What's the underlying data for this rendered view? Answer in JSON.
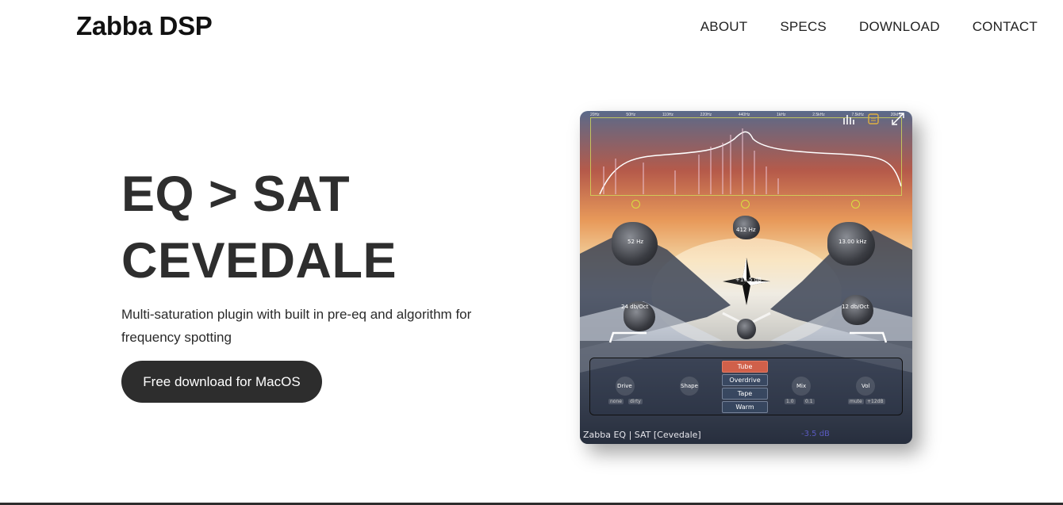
{
  "header": {
    "brand": "Zabba DSP",
    "nav": [
      "ABOUT",
      "SPECS",
      "DOWNLOAD",
      "CONTACT"
    ]
  },
  "hero": {
    "title_line1": "EQ > SAT",
    "title_line2": "CEVEDALE",
    "description": "Multi-saturation plugin with built in pre-eq and algorithm for frequency spotting",
    "cta_label": "Free download for MacOS"
  },
  "plugin": {
    "freq_labels": [
      "20Hz",
      "50Hz",
      "110Hz",
      "220Hz",
      "440Hz",
      "1kHz",
      "2.5kHz",
      "7.5kHz",
      "20kHz"
    ],
    "bands": {
      "low_freq": "52 Hz",
      "mid_freq": "412 Hz",
      "high_freq": "13.00 kHz",
      "low_slope": "24 db/Oct",
      "high_slope": "12 db/Oct",
      "center_gain": "+16.5 dB"
    },
    "controls": {
      "drive": "Drive",
      "shape": "Shape",
      "mix": "Mix",
      "vol": "Vol",
      "drive_opts": [
        "none",
        "dirty"
      ],
      "mix_opts": [
        "1.0",
        "0.1"
      ],
      "vol_opts": [
        "mute",
        "+12dB"
      ]
    },
    "sat_modes": [
      "Tube",
      "Overdrive",
      "Tape",
      "Warm"
    ],
    "active_mode": "Tube",
    "name": "Zabba EQ | SAT [Cevedale]",
    "output_level": "-3.5 dB"
  },
  "colors": {
    "cta_bg": "#2d2d2d",
    "active_mode": "#d0604a",
    "eq_outline": "#d8e040"
  },
  "icons": [
    "spectrum-icon",
    "tube-icon",
    "expand-icon",
    "power-icon",
    "compass-star-icon"
  ]
}
